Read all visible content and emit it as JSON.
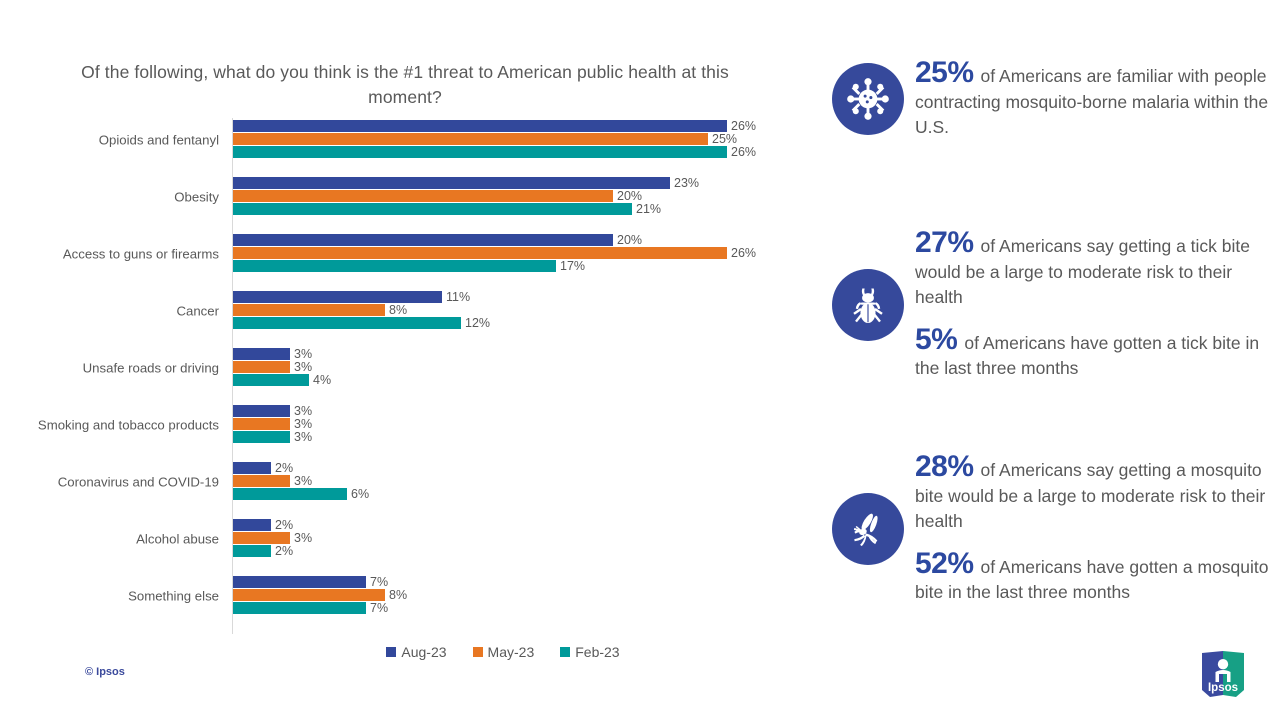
{
  "chart_data": {
    "type": "bar",
    "orientation": "horizontal",
    "title": "Of the following, what do you think is the #1 threat to American public health at this moment?",
    "xlabel": "",
    "ylabel": "",
    "grid": false,
    "legend_position": "bottom",
    "xlim": [
      0,
      28
    ],
    "categories": [
      "Opioids and fentanyl",
      "Obesity",
      "Access to guns or firearms",
      "Cancer",
      "Unsafe roads or driving",
      "Smoking and tobacco products",
      "Coronavirus and COVID-19",
      "Alcohol abuse",
      "Something else"
    ],
    "series": [
      {
        "name": "Aug-23",
        "color": "#32489B",
        "values": [
          26,
          23,
          20,
          11,
          3,
          3,
          2,
          2,
          7
        ]
      },
      {
        "name": "May-23",
        "color": "#E87722",
        "values": [
          25,
          20,
          26,
          8,
          3,
          3,
          3,
          3,
          8
        ]
      },
      {
        "name": "Feb-23",
        "color": "#009A9A",
        "values": [
          26,
          21,
          17,
          12,
          4,
          3,
          6,
          2,
          7
        ]
      }
    ],
    "value_labels": [
      [
        "26%",
        "25%",
        "26%"
      ],
      [
        "23%",
        "20%",
        "21%"
      ],
      [
        "20%",
        "26%",
        "17%"
      ],
      [
        "11%",
        "8%",
        "12%"
      ],
      [
        "3%",
        "3%",
        "4%"
      ],
      [
        "3%",
        "3%",
        "3%"
      ],
      [
        "2%",
        "3%",
        "6%"
      ],
      [
        "2%",
        "3%",
        "2%"
      ],
      [
        "7%",
        "8%",
        "7%"
      ]
    ]
  },
  "chart": {
    "title": "Of the following, what do you think is the #1 threat to American public health at this moment?",
    "copyright": "© Ipsos"
  },
  "legend": {
    "items": [
      {
        "label": "Aug-23"
      },
      {
        "label": "May-23"
      },
      {
        "label": "Feb-23"
      }
    ]
  },
  "stats": [
    {
      "icon": "virus-icon",
      "paragraphs": [
        {
          "pct": "25%",
          "text": "of Americans are familiar with people contracting mosquito-borne malaria within the U.S."
        }
      ]
    },
    {
      "icon": "tick-icon",
      "paragraphs": [
        {
          "pct": "27%",
          "text": "of Americans say getting a tick bite would be a large to moderate risk to their health"
        },
        {
          "pct": "5%",
          "text": "of Americans have gotten a tick bite in the last three months"
        }
      ]
    },
    {
      "icon": "mosquito-icon",
      "paragraphs": [
        {
          "pct": "28%",
          "text": "of Americans say getting a mosquito bite would be a large to moderate risk to their health"
        },
        {
          "pct": "52%",
          "text": "of Americans have gotten a mosquito bite in the last three months"
        }
      ]
    }
  ],
  "logo": {
    "text": "Ipsos"
  },
  "colors": {
    "series_aug": "#32489B",
    "series_may": "#E87722",
    "series_feb": "#009A9A",
    "icon_blue": "#36499B",
    "accent_blue": "#2c49a0",
    "text_gray": "#595959"
  }
}
